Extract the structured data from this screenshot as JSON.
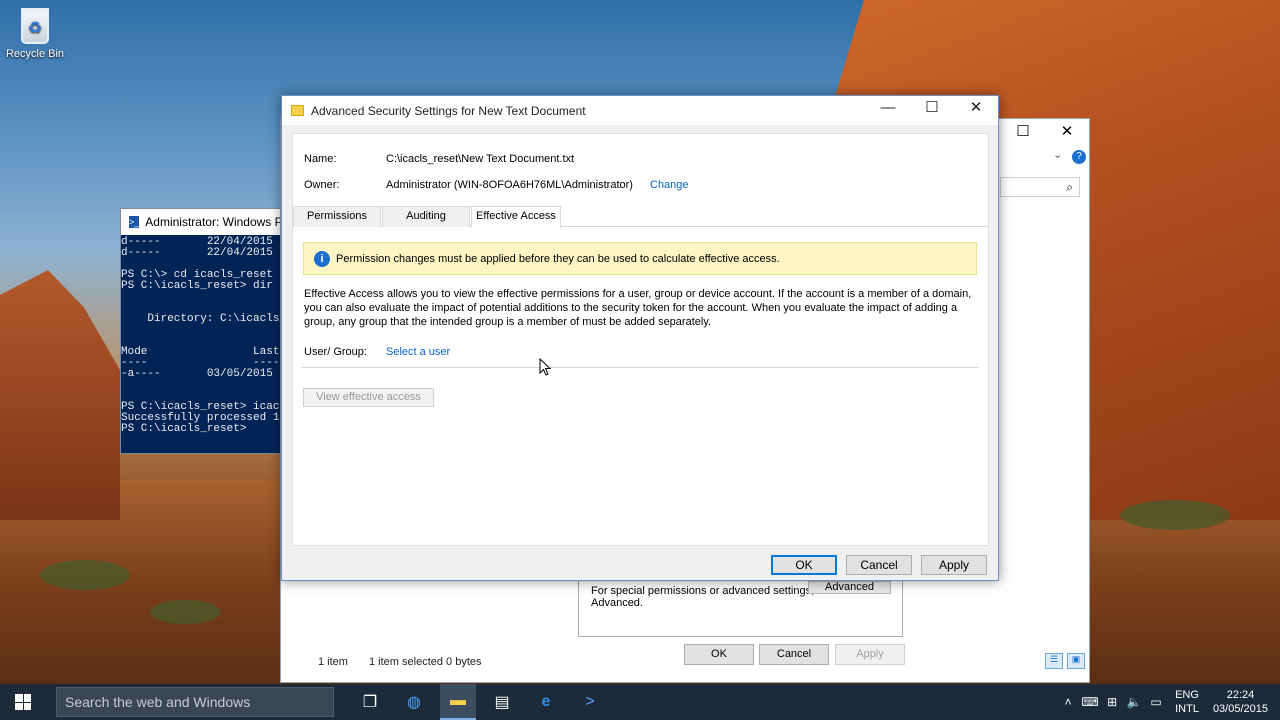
{
  "desktop": {
    "recycle_bin": "Recycle Bin"
  },
  "powershell": {
    "title": "Administrator: Windows Po",
    "lines": [
      "d-----       22/04/2015",
      "d-----       22/04/2015",
      "",
      "PS C:\\> cd icacls_reset",
      "PS C:\\icacls_reset> dir",
      "",
      "",
      "    Directory: C:\\icacls_",
      "",
      "",
      "Mode                Last",
      "----                ----",
      "-a----       03/05/2015",
      "",
      "",
      "PS C:\\icacls_reset> icac",
      "Successfully processed 1",
      "PS C:\\icacls_reset>"
    ]
  },
  "background_window": {
    "perm_text": "For special permissions or advanced settings, click Advanced.",
    "advanced_label": "Advanced",
    "ok_label": "OK",
    "cancel_label": "Cancel",
    "apply_label": "Apply",
    "status_items": "1 item",
    "status_selected": "1 item selected  0 bytes"
  },
  "dialog": {
    "title": "Advanced Security Settings for New Text Document",
    "name_label": "Name:",
    "name_value": "C:\\icacls_reset\\New Text Document.txt",
    "owner_label": "Owner:",
    "owner_value": "Administrator (WIN-8OFOA6H76ML\\Administrator)",
    "change_link": "Change",
    "tabs": [
      "Permissions",
      "Auditing",
      "Effective Access"
    ],
    "active_tab": "Effective Access",
    "info_message": "Permission changes must be applied before they can be used to calculate effective access.",
    "description": "Effective Access allows you to view the effective permissions for a user, group or device account. If the account is a member of a domain, you can also evaluate the impact of potential additions to the security token for the account. When you evaluate the impact of adding a group, any group that the intended group is a member of must be added separately.",
    "user_group_label": "User/ Group:",
    "select_user_link": "Select a user",
    "view_effective_access": "View effective access",
    "ok_label": "OK",
    "cancel_label": "Cancel",
    "apply_label": "Apply"
  },
  "taskbar": {
    "search_placeholder": "Search the web and Windows",
    "lang_top": "ENG",
    "lang_bottom": "INTL",
    "time": "22:24",
    "date": "03/05/2015"
  },
  "colors": {
    "accent": "#0078d7",
    "link": "#0a63c4",
    "info_bg": "#fcf6c4",
    "ps_bg": "#012456"
  }
}
